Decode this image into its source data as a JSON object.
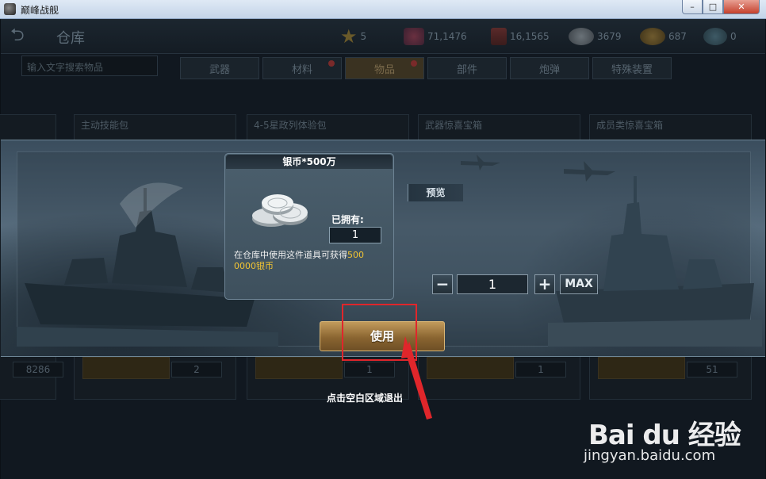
{
  "window": {
    "title": "巅峰战舰",
    "min_glyph": "–",
    "max_glyph": "□",
    "close_glyph": "✕"
  },
  "topbar": {
    "title": "仓库",
    "resources": [
      {
        "icon": "star-icon",
        "value": "5"
      },
      {
        "icon": "gems-icon",
        "value": "71,1476"
      },
      {
        "icon": "supply-crate-icon",
        "value": "16,1565"
      },
      {
        "icon": "silver-coins-icon",
        "value": "3679"
      },
      {
        "icon": "gold-coins-icon",
        "value": "687"
      },
      {
        "icon": "blue-coins-icon",
        "value": "0"
      }
    ]
  },
  "search": {
    "placeholder": "输入文字搜索物品"
  },
  "tabs": [
    {
      "label": "武器"
    },
    {
      "label": "材料"
    },
    {
      "label": "物品"
    },
    {
      "label": "部件"
    },
    {
      "label": "炮弹"
    },
    {
      "label": "特殊装置"
    }
  ],
  "background_cards": [
    {
      "title": "",
      "count": "8286"
    },
    {
      "title": "主动技能包",
      "count": "2"
    },
    {
      "title": "4-5星政列体验包",
      "count": "1"
    },
    {
      "title": "武器惊喜宝箱",
      "count": "1"
    },
    {
      "title": "成员类惊喜宝箱",
      "count": "51"
    }
  ],
  "item_panel": {
    "title": "银币*500万",
    "owned_label": "已拥有:",
    "owned_value": "1",
    "desc_prefix": "在仓库中使用这件道具可获得",
    "desc_amount_1": "500",
    "desc_amount_2": "0000",
    "desc_suffix": "银币"
  },
  "preview_label": "预览",
  "quantity": {
    "minus": "−",
    "value": "1",
    "plus": "+",
    "max": "MAX"
  },
  "use_button": "使用",
  "exit_hint": "点击空白区域退出",
  "watermark": {
    "logo": "Bai du 经验",
    "url": "jingyan.baidu.com"
  },
  "colors": {
    "accent_gold": "#f2c433",
    "highlight_red": "#e0262b"
  }
}
